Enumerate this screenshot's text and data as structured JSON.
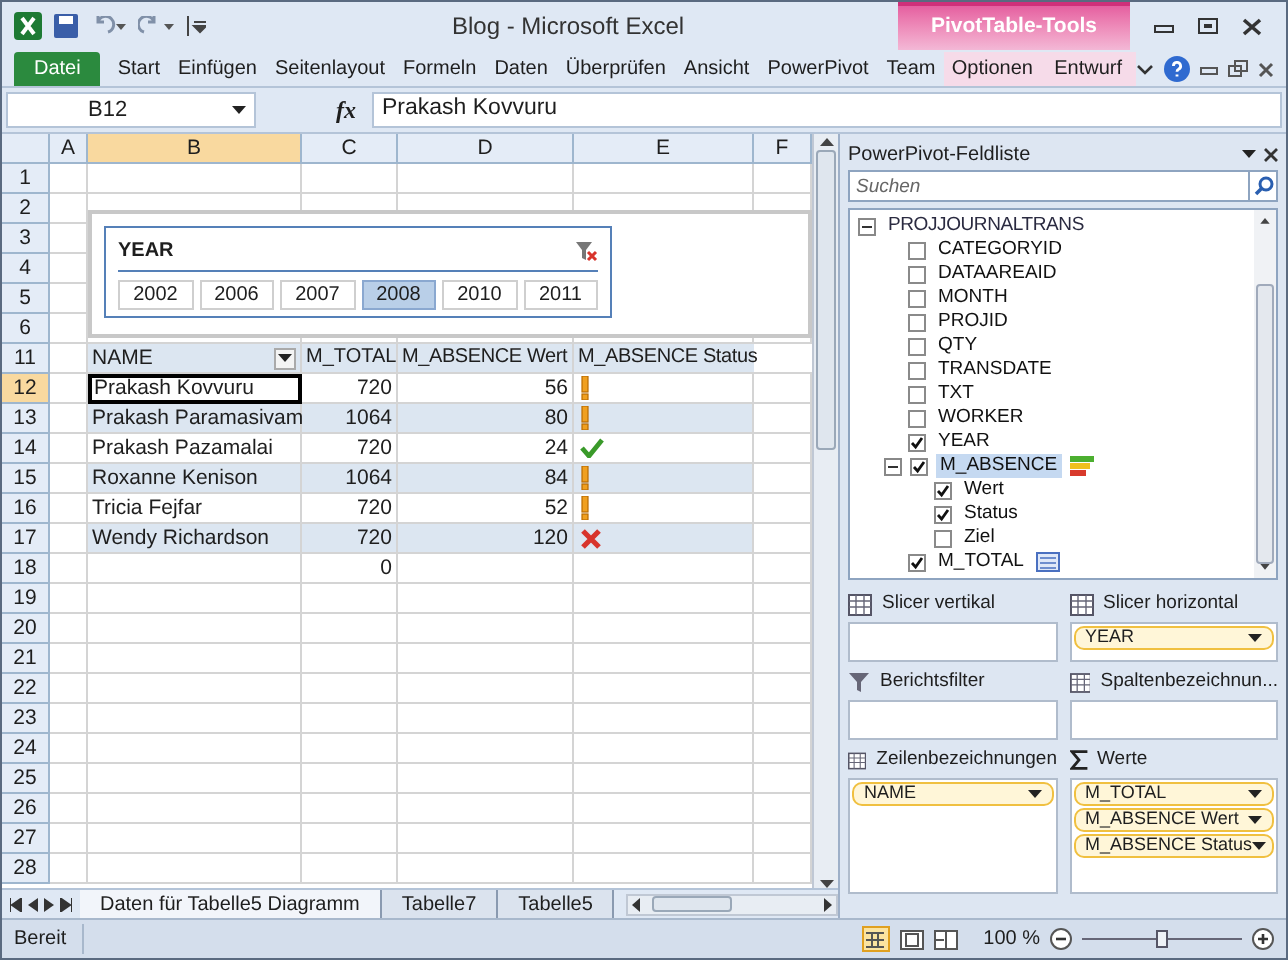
{
  "window": {
    "title": "Blog - Microsoft Excel",
    "context_tab": "PivotTable-Tools"
  },
  "ribbon_tabs": [
    {
      "label": "Datei",
      "kind": "file",
      "selected": false
    },
    {
      "label": "Start",
      "kind": "tab",
      "selected": false
    },
    {
      "label": "Einfügen",
      "kind": "tab",
      "selected": false
    },
    {
      "label": "Seitenlayout",
      "kind": "tab",
      "selected": false
    },
    {
      "label": "Formeln",
      "kind": "tab",
      "selected": false
    },
    {
      "label": "Daten",
      "kind": "tab",
      "selected": false
    },
    {
      "label": "Überprüfen",
      "kind": "tab",
      "selected": false
    },
    {
      "label": "Ansicht",
      "kind": "tab",
      "selected": false
    },
    {
      "label": "PowerPivot",
      "kind": "tab",
      "selected": false
    },
    {
      "label": "Team",
      "kind": "tab",
      "selected": false
    },
    {
      "label": "Optionen",
      "kind": "context",
      "selected": false
    },
    {
      "label": "Entwurf",
      "kind": "context",
      "selected": false
    }
  ],
  "formula_bar": {
    "name_box": "B12",
    "function_label": "fx",
    "value": "Prakash Kovvuru"
  },
  "sheet": {
    "columns": [
      {
        "label": "A",
        "selected": false
      },
      {
        "label": "B",
        "selected": true
      },
      {
        "label": "C",
        "selected": false
      },
      {
        "label": "D",
        "selected": false
      },
      {
        "label": "E",
        "selected": false
      },
      {
        "label": "F",
        "selected": false
      }
    ],
    "row_numbers": [
      {
        "label": "1",
        "selected": false
      },
      {
        "label": "2",
        "selected": false
      },
      {
        "label": "3",
        "selected": false
      },
      {
        "label": "4",
        "selected": false
      },
      {
        "label": "5",
        "selected": false
      },
      {
        "label": "6",
        "selected": false
      },
      {
        "label": "11",
        "selected": false
      },
      {
        "label": "12",
        "selected": true
      },
      {
        "label": "13",
        "selected": false
      },
      {
        "label": "14",
        "selected": false
      },
      {
        "label": "15",
        "selected": false
      },
      {
        "label": "16",
        "selected": false
      },
      {
        "label": "17",
        "selected": false
      },
      {
        "label": "18",
        "selected": false
      },
      {
        "label": "19",
        "selected": false
      },
      {
        "label": "20",
        "selected": false
      },
      {
        "label": "21",
        "selected": false
      },
      {
        "label": "22",
        "selected": false
      },
      {
        "label": "23",
        "selected": false
      },
      {
        "label": "24",
        "selected": false
      },
      {
        "label": "25",
        "selected": false
      },
      {
        "label": "26",
        "selected": false
      },
      {
        "label": "27",
        "selected": false
      },
      {
        "label": "28",
        "selected": false
      }
    ],
    "slicer": {
      "title": "YEAR",
      "items": [
        {
          "label": "2002",
          "selected": false
        },
        {
          "label": "2006",
          "selected": false
        },
        {
          "label": "2007",
          "selected": false
        },
        {
          "label": "2008",
          "selected": true
        },
        {
          "label": "2010",
          "selected": false
        },
        {
          "label": "2011",
          "selected": false
        }
      ]
    },
    "pivot": {
      "columns": [
        "NAME",
        "M_TOTAL",
        "M_ABSENCE Wert",
        "M_ABSENCE Status"
      ],
      "rows": [
        {
          "name": "Prakash Kovvuru",
          "total": "720",
          "wert": "56",
          "kind": "warning",
          "selected": true
        },
        {
          "name": "Prakash Paramasivam",
          "total": "1064",
          "wert": "80",
          "kind": "warning",
          "selected": false
        },
        {
          "name": "Prakash Pazamalai",
          "total": "720",
          "wert": "24",
          "kind": "ok",
          "selected": false
        },
        {
          "name": "Roxanne Kenison",
          "total": "1064",
          "wert": "84",
          "kind": "warning",
          "selected": false
        },
        {
          "name": "Tricia Fejfar",
          "total": "720",
          "wert": "52",
          "kind": "warning",
          "selected": false
        },
        {
          "name": "Wendy Richardson",
          "total": "720",
          "wert": "120",
          "kind": "error",
          "selected": false
        }
      ],
      "grand_total": "0"
    },
    "sheet_tabs": [
      {
        "label": "Daten für Tabelle5 Diagramm",
        "selected": true
      },
      {
        "label": "Tabelle7",
        "selected": false
      },
      {
        "label": "Tabelle5",
        "selected": false
      }
    ]
  },
  "field_list": {
    "title": "PowerPivot-Feldliste",
    "search": {
      "placeholder": "Suchen"
    },
    "tree": [
      {
        "label": "PROJJOURNALTRANS",
        "kind": "table",
        "expanded": true,
        "selected": false,
        "children": [
          {
            "label": "CATEGORYID",
            "kind": "field",
            "checked": false,
            "selected": false
          },
          {
            "label": "DATAAREAID",
            "kind": "field",
            "checked": false,
            "selected": false
          },
          {
            "label": "MONTH",
            "kind": "field",
            "checked": false,
            "selected": false
          },
          {
            "label": "PROJID",
            "kind": "field",
            "checked": false,
            "selected": false
          },
          {
            "label": "QTY",
            "kind": "field",
            "checked": false,
            "selected": false
          },
          {
            "label": "TRANSDATE",
            "kind": "field",
            "checked": false,
            "selected": false
          },
          {
            "label": "TXT",
            "kind": "field",
            "checked": false,
            "selected": false
          },
          {
            "label": "WORKER",
            "kind": "field",
            "checked": false,
            "selected": false
          },
          {
            "label": "YEAR",
            "kind": "field",
            "checked": true,
            "selected": false
          },
          {
            "label": "M_ABSENCE",
            "kind": "kpi",
            "checked": true,
            "expanded": true,
            "selected": true,
            "children": [
              {
                "label": "Wert",
                "checked": true,
                "selected": false
              },
              {
                "label": "Status",
                "checked": true,
                "selected": false
              },
              {
                "label": "Ziel",
                "checked": false,
                "selected": false
              }
            ]
          },
          {
            "label": "M_TOTAL",
            "kind": "measure",
            "checked": true,
            "selected": false
          }
        ]
      }
    ],
    "areas": [
      {
        "label": "Slicer vertikal",
        "kind": "slicer_vertical"
      },
      {
        "label": "Slicer horizontal",
        "kind": "slicer_horizontal",
        "items": [
          "YEAR"
        ]
      },
      {
        "label": "Berichtsfilter",
        "kind": "filter"
      },
      {
        "label": "Spaltenbezeichnun...",
        "kind": "columns"
      },
      {
        "label": "Zeilenbezeichnungen",
        "kind": "rows",
        "items": [
          "NAME"
        ]
      },
      {
        "label": "Werte",
        "kind": "values",
        "items": [
          "M_TOTAL",
          "M_ABSENCE Wert",
          "M_ABSENCE Status"
        ]
      }
    ]
  },
  "status_bar": {
    "text": "Bereit",
    "zoom": "100 %",
    "zoom_level": {
      "level": 0.5
    }
  }
}
